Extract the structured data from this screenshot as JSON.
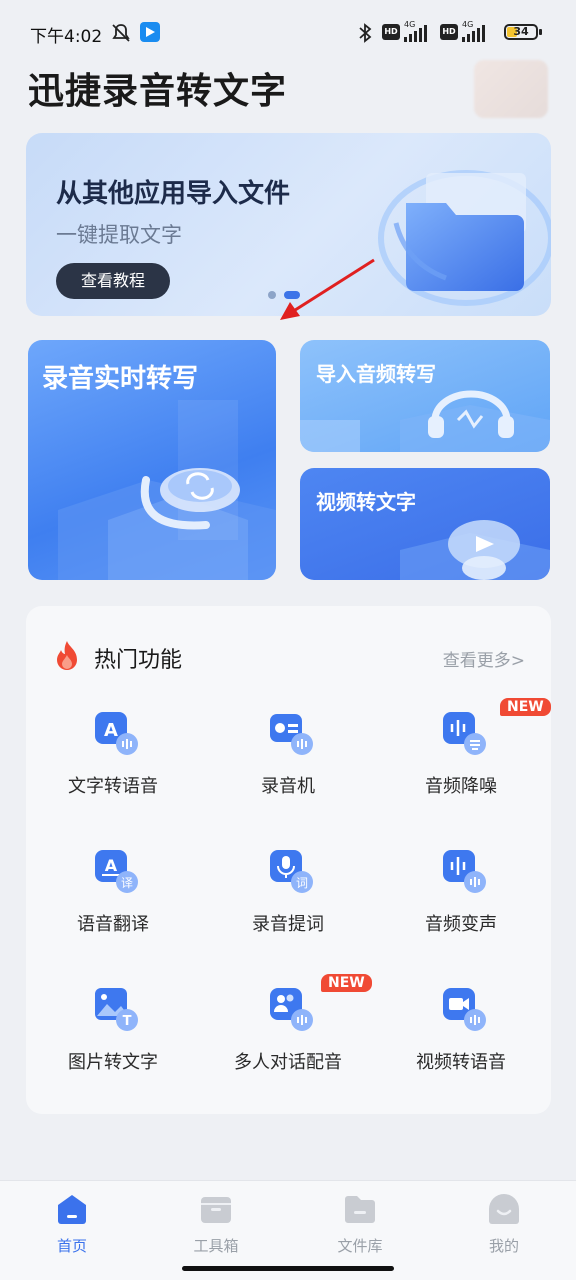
{
  "status": {
    "time": "下午4:02",
    "battery": "34",
    "battery_level": 0.34,
    "network": [
      "4G",
      "4G"
    ],
    "hd": [
      "HD",
      "HD"
    ]
  },
  "header": {
    "title": "迅捷录音转文字"
  },
  "banner": {
    "title": "从其他应用导入文件",
    "subtitle": "一键提取文字",
    "button": "查看教程",
    "page_index": 2,
    "page_count": 2
  },
  "cards": {
    "realtime": "录音实时转写",
    "audio_import": "导入音频转写",
    "video_text": "视频转文字"
  },
  "hot": {
    "title": "热门功能",
    "more": "查看更多>",
    "new_label": "NEW",
    "items": [
      {
        "label": "文字转语音",
        "icon": "text-to-speech-icon"
      },
      {
        "label": "录音机",
        "icon": "recorder-icon"
      },
      {
        "label": "音频降噪",
        "icon": "noise-reduction-icon",
        "new": true
      },
      {
        "label": "语音翻译",
        "icon": "voice-translate-icon"
      },
      {
        "label": "录音提词",
        "icon": "teleprompter-icon"
      },
      {
        "label": "音频变声",
        "icon": "voice-changer-icon"
      },
      {
        "label": "图片转文字",
        "icon": "image-to-text-icon"
      },
      {
        "label": "多人对话配音",
        "icon": "multi-dubbing-icon",
        "new": true
      },
      {
        "label": "视频转语音",
        "icon": "video-to-audio-icon"
      }
    ]
  },
  "nav": [
    {
      "label": "首页",
      "active": true
    },
    {
      "label": "工具箱"
    },
    {
      "label": "文件库"
    },
    {
      "label": "我的"
    }
  ],
  "colors": {
    "accent": "#3b72ec",
    "highlight_box": "#e02020",
    "new_badge": "#f04a34"
  }
}
